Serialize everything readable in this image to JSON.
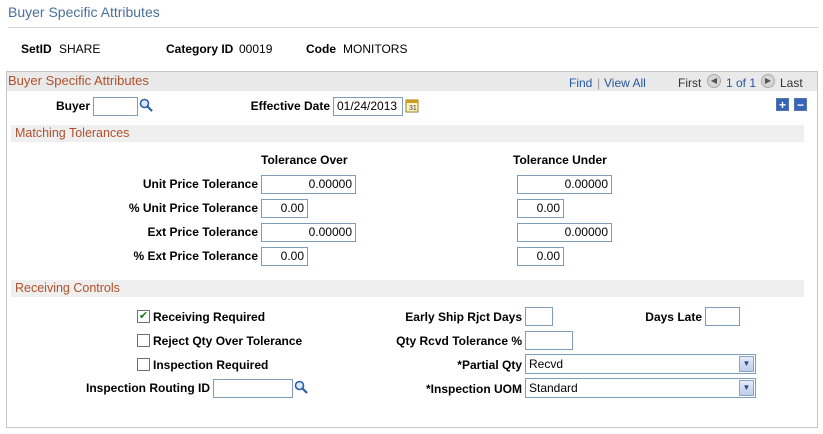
{
  "page": {
    "title": "Buyer Specific Attributes"
  },
  "header": {
    "setid_label": "SetID",
    "setid_value": "SHARE",
    "category_label": "Category ID",
    "category_value": "00019",
    "code_label": "Code",
    "code_value": "MONITORS"
  },
  "grid": {
    "title": "Buyer Specific Attributes",
    "find": "Find",
    "sep": "|",
    "view_all": "View All",
    "first": "First",
    "page_info": "1 of 1",
    "last": "Last"
  },
  "buyer": {
    "label": "Buyer",
    "value": ""
  },
  "effective_date": {
    "label": "Effective Date",
    "value": "01/24/2013"
  },
  "matching": {
    "title": "Matching Tolerances",
    "col_over": "Tolerance Over",
    "col_under": "Tolerance Under",
    "rows": [
      {
        "label": "Unit Price Tolerance",
        "over": "0.00000",
        "under": "0.00000"
      },
      {
        "label": "% Unit Price Tolerance",
        "over": "0.00",
        "under": "0.00"
      },
      {
        "label": "Ext Price Tolerance",
        "over": "0.00000",
        "under": "0.00000"
      },
      {
        "label": "% Ext Price Tolerance",
        "over": "0.00",
        "under": "0.00"
      }
    ]
  },
  "receiving": {
    "title": "Receiving Controls",
    "receiving_required": {
      "label": "Receiving Required",
      "checked": true
    },
    "reject_qty": {
      "label": "Reject Qty Over Tolerance",
      "checked": false
    },
    "inspection_required": {
      "label": "Inspection Required",
      "checked": false
    },
    "inspection_routing": {
      "label": "Inspection Routing ID",
      "value": ""
    },
    "early_ship": {
      "label": "Early Ship Rjct Days",
      "value": ""
    },
    "days_late": {
      "label": "Days Late",
      "value": ""
    },
    "qty_rcvd_tol": {
      "label": "Qty Rcvd Tolerance %",
      "value": ""
    },
    "partial_qty": {
      "label": "*Partial Qty",
      "value": "Recvd"
    },
    "inspection_uom": {
      "label": "*Inspection UOM",
      "value": "Standard"
    }
  }
}
